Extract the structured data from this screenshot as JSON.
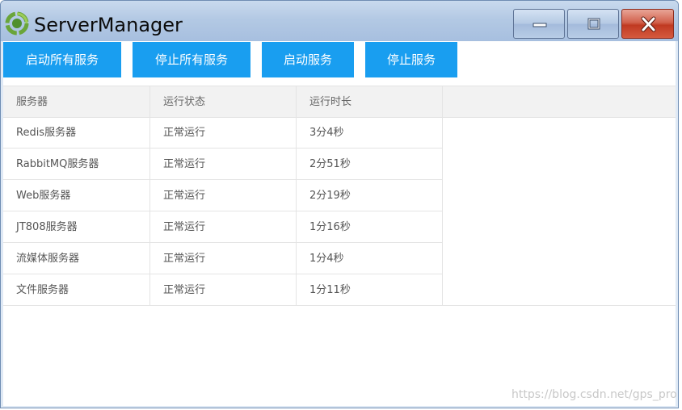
{
  "window": {
    "title": "ServerManager",
    "controls": [
      "minimize-icon",
      "maximize-icon",
      "close-icon"
    ]
  },
  "toolbar": {
    "buttons": [
      {
        "label": "启动所有服务"
      },
      {
        "label": "停止所有服务"
      },
      {
        "label": "启动服务"
      },
      {
        "label": "停止服务"
      }
    ]
  },
  "table": {
    "headers": [
      "服务器",
      "运行状态",
      "运行时长"
    ],
    "rows": [
      [
        "Redis服务器",
        "正常运行",
        "3分4秒"
      ],
      [
        "RabbitMQ服务器",
        "正常运行",
        "2分51秒"
      ],
      [
        "Web服务器",
        "正常运行",
        "2分19秒"
      ],
      [
        "JT808服务器",
        "正常运行",
        "1分16秒"
      ],
      [
        "流媒体服务器",
        "正常运行",
        "1分4秒"
      ],
      [
        "文件服务器",
        "正常运行",
        "1分11秒"
      ]
    ]
  },
  "watermark": "https://blog.csdn.net/gps_pro",
  "colors": {
    "button_bg": "#199ef0",
    "button_text": "#ffffff",
    "header_bg": "#f2f2f2",
    "close_button": "#c03a22"
  }
}
